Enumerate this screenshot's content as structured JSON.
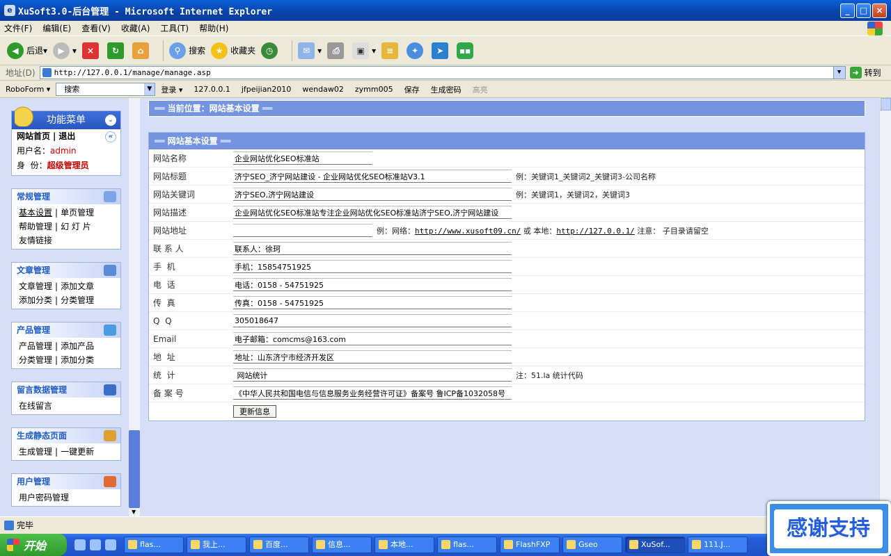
{
  "window": {
    "title": "XuSoft3.0-后台管理 - Microsoft Internet Explorer",
    "min": "_",
    "max": "□",
    "close": "×"
  },
  "menu": [
    "文件(F)",
    "编辑(E)",
    "查看(V)",
    "收藏(A)",
    "工具(T)",
    "帮助(H)"
  ],
  "toolbar": {
    "back": "后退",
    "search": "搜索",
    "favorites": "收藏夹"
  },
  "address": {
    "label": "地址(D)",
    "url": "http://127.0.0.1/manage/manage.asp",
    "go": "转到"
  },
  "roboform": {
    "brand": "RoboForm ▾",
    "search": "搜索",
    "login": "登录 ▾",
    "items": [
      "127.0.0.1",
      "jfpeijian2010",
      "wendaw02",
      "zymm005"
    ],
    "save": "保存",
    "generate": "生成密码",
    "highlight": "高亮"
  },
  "sidebar": {
    "title": "功能菜单",
    "home": "网站首页",
    "logout": "退出",
    "pipe": "|",
    "user_label": "用户名：",
    "user_value": "admin",
    "role_label": "身  份：",
    "role_value": "超级管理员",
    "sections": [
      {
        "title": "常规管理",
        "rows": [
          [
            "基本设置",
            "单页管理"
          ],
          [
            "帮助管理",
            "幻 灯 片"
          ],
          [
            "友情链接"
          ]
        ]
      },
      {
        "title": "文章管理",
        "rows": [
          [
            "文章管理",
            "添加文章"
          ],
          [
            "添加分类",
            "分类管理"
          ]
        ]
      },
      {
        "title": "产品管理",
        "rows": [
          [
            "产品管理",
            "添加产品"
          ],
          [
            "分类管理",
            "添加分类"
          ]
        ]
      },
      {
        "title": "留言数据管理",
        "rows": [
          [
            "在线留言"
          ]
        ]
      },
      {
        "title": "生成静态页面",
        "rows": [
          [
            "生成管理",
            "一键更新"
          ]
        ]
      },
      {
        "title": "用户管理",
        "rows": [
          [
            "用户密码管理"
          ]
        ]
      }
    ]
  },
  "main": {
    "location": "══ 当前位置：网站基本设置 ══",
    "panel_title": "══ 网站基本设置 ══",
    "fields": [
      {
        "label": "网站名称",
        "value": "企业网站优化SEO标准站",
        "hint": ""
      },
      {
        "label": "网站标题",
        "value": "济宁SEO_济宁网站建设 - 企业网站优化SEO标准站V3.1",
        "hint": "例：关键词1_关键词2_关键词3-公司名称"
      },
      {
        "label": "网站关键词",
        "value": "济宁SEO,济宁网站建设",
        "hint": "例：关键词1，关键词2，关键词3"
      },
      {
        "label": "网站描述",
        "value": "企业网站优化SEO标准站专注企业网站优化SEO标准站济宁SEO,济宁网站建设",
        "hint": ""
      },
      {
        "label": "网站地址",
        "value": "",
        "hint": ""
      },
      {
        "label": "联 系 人",
        "value": "联系人：徐珂",
        "hint": ""
      },
      {
        "label": "手  机",
        "value": "手机：15854751925",
        "hint": ""
      },
      {
        "label": "电  话",
        "value": "电话：0158 - 54751925",
        "hint": ""
      },
      {
        "label": "传  真",
        "value": "传真：0158 - 54751925",
        "hint": ""
      },
      {
        "label": "Q  Q",
        "value": "305018647",
        "hint": ""
      },
      {
        "label": "Email",
        "value": "电子邮箱：comcms@163.com",
        "hint": ""
      },
      {
        "label": "地  址",
        "value": "地址：山东济宁市经济开发区",
        "hint": ""
      },
      {
        "label": "统  计",
        "value": " 网站统计",
        "hint": "注：51.la 统计代码"
      },
      {
        "label": "备 案 号",
        "value": "《中华人民共和国电信与信息服务业务经营许可证》备案号 鲁ICP备1032058号",
        "hint": ""
      }
    ],
    "url_hint": {
      "pre": "例：网络：",
      "net": "http://www.xusoft09.cn/",
      "mid": " 或 本地：",
      "local": "http://127.0.0.1/",
      "post": " 注意： 子目录请留空"
    },
    "submit": "更新信息"
  },
  "status": "完毕",
  "taskbar": {
    "start": "开始",
    "tasks": [
      "flas...",
      "我上...",
      "百度...",
      "信息...",
      "本地...",
      "flas...",
      "FlashFXP",
      "Gseo",
      "XuSof...",
      "111.J..."
    ],
    "active_index": 8
  },
  "overlay": "感谢支持"
}
